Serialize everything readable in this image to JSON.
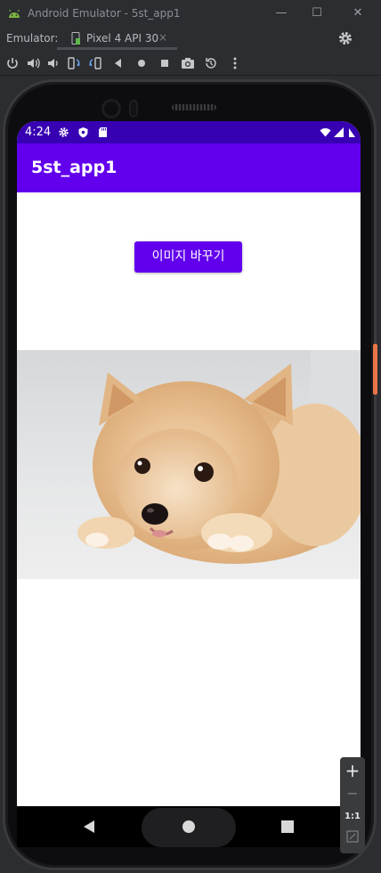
{
  "window": {
    "title": "Android Emulator - 5st_app1",
    "controls": [
      "—",
      "☐",
      "✕"
    ]
  },
  "emulator_bar": {
    "label": "Emulator:",
    "tab_label": "Pixel 4 API 30",
    "tab_close": "×"
  },
  "toolbar_icons": [
    "power-icon",
    "volume-up-icon",
    "volume-down-icon",
    "rotate-left-icon",
    "rotate-right-icon",
    "back-icon",
    "home-icon",
    "overview-icon",
    "screenshot-icon",
    "snapshot-icon",
    "more-icon"
  ],
  "phone": {
    "status_time": "4:24",
    "app_title": "5st_app1",
    "button_label": "이미지 바꾸기",
    "photo_alt": "pomeranian-photo"
  },
  "zoom": {
    "plus": "+",
    "minus": "−",
    "ratio": "1:1"
  },
  "colors": {
    "status_bar": "#3700b3",
    "app_bar": "#6200ee",
    "accent_button": "#6200ee"
  }
}
